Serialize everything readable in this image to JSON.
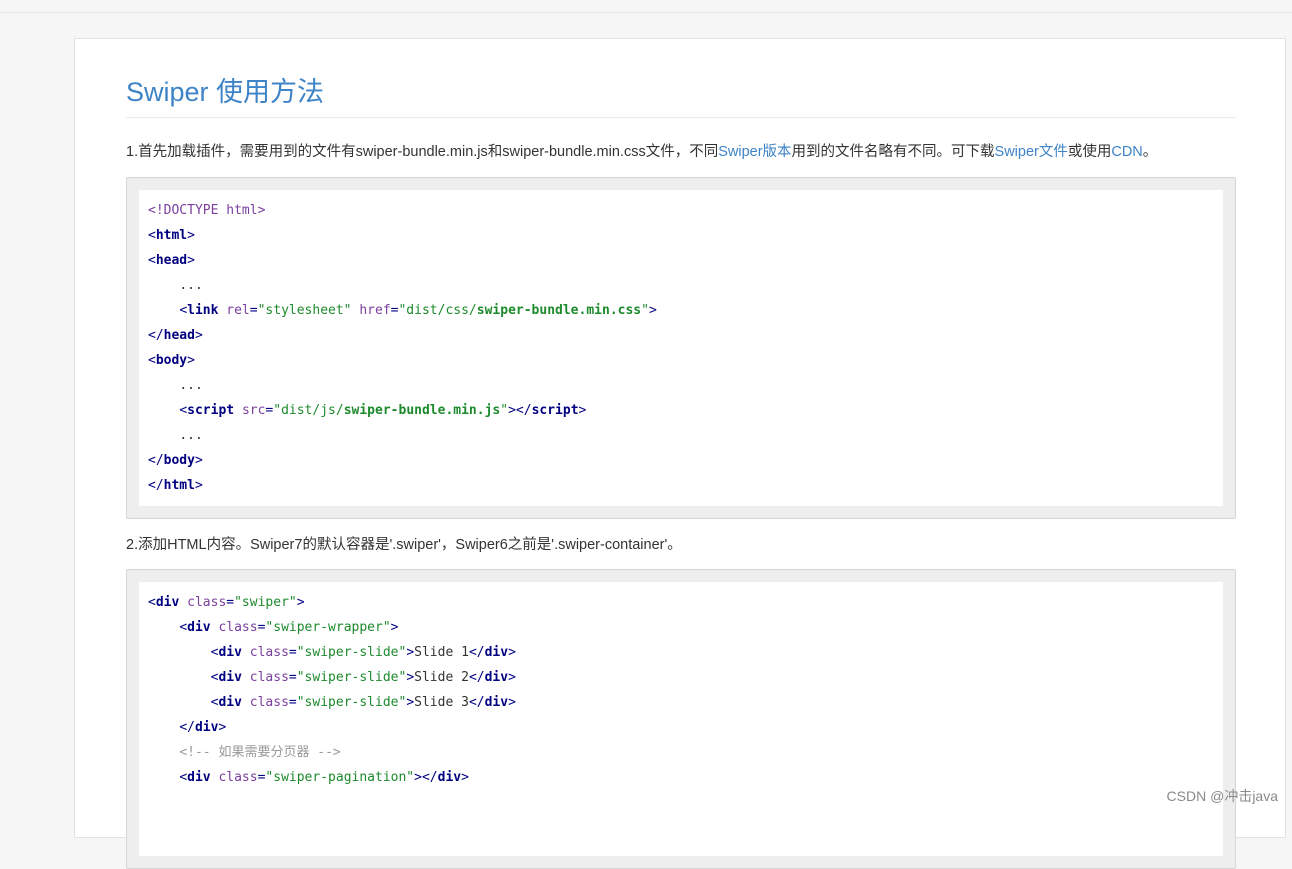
{
  "article": {
    "title": "Swiper 使用方法",
    "para1": {
      "text_a": "1.首先加载插件，需要用到的文件有swiper-bundle.min.js和swiper-bundle.min.css文件，不同",
      "link_a": "Swiper版本",
      "text_b": "用到的文件名略有不同。可下载",
      "link_b": "Swiper文件",
      "text_c": "或使用",
      "link_c": "CDN",
      "text_d": "。"
    },
    "para2": "2.添加HTML内容。Swiper7的默认容器是'.swiper'，Swiper6之前是'.swiper-container'。"
  },
  "code1": {
    "doctype": "<!DOCTYPE html>",
    "html": "html",
    "head": "head",
    "ellipsis": "...",
    "link": "link",
    "rel_attr": "rel",
    "rel_val_open": "\"stylesheet\"",
    "href_attr": "href",
    "href_val_path": "\"dist/css/",
    "href_val_file": "swiper-bundle.min.css",
    "href_val_close": "\"",
    "body": "body",
    "script": "script",
    "src_attr": "src",
    "src_val_path": "\"dist/js/",
    "src_val_file": "swiper-bundle.min.js",
    "src_val_close": "\""
  },
  "code2": {
    "div": "div",
    "class_attr": "class",
    "swiper_val": "\"swiper\"",
    "wrapper_val": "\"swiper-wrapper\"",
    "slide_val": "\"swiper-slide\"",
    "slide1": "Slide 1",
    "slide2": "Slide 2",
    "slide3": "Slide 3",
    "comment": "<!-- 如果需要分页器 -->",
    "pagination_val": "\"swiper-pagination\""
  },
  "watermark": "CSDN @冲击java",
  "colors": {
    "link": "#3e84c6",
    "tag": "#000080",
    "attr": "#7b3f9e",
    "string": "#1d8a2c",
    "comment": "#999999"
  }
}
